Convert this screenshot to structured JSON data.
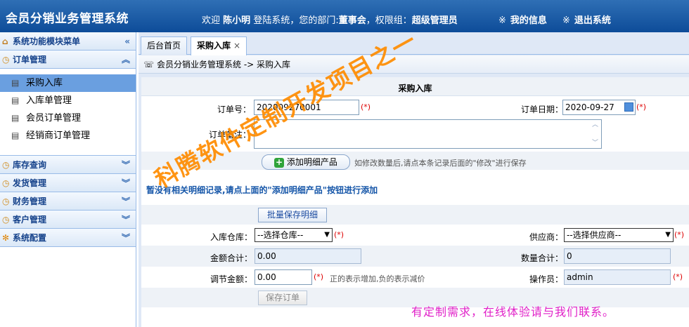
{
  "header": {
    "app_title": "会员分销业务管理系统",
    "welcome_prefix": "欢迎",
    "user_name": "陈小明",
    "welcome_mid": "登陆系统，您的部门:",
    "department": "董事会",
    "role_prefix": "，权限组：",
    "role": "超级管理员",
    "my_info": "我的信息",
    "logout": "退出系统",
    "link_mark": "※"
  },
  "sidebar": {
    "menu_title": "系统功能模块菜单",
    "groups": [
      {
        "label": "订单管理",
        "expanded": true
      },
      {
        "label": "库存查询"
      },
      {
        "label": "发货管理"
      },
      {
        "label": "财务管理"
      },
      {
        "label": "客户管理"
      },
      {
        "label": "系统配置"
      }
    ],
    "items": [
      {
        "label": "采购入库",
        "active": true
      },
      {
        "label": "入库单管理"
      },
      {
        "label": "会员订单管理"
      },
      {
        "label": "经销商订单管理"
      }
    ]
  },
  "tabs": [
    {
      "label": "后台首页"
    },
    {
      "label": "采购入库",
      "active": true,
      "close": "×"
    }
  ],
  "breadcrumb": "会员分销业务管理系统 -> 采购入库",
  "form": {
    "section_title": "采购入库",
    "order_no_label": "订单号：",
    "order_no_value": "202009270001",
    "required_mark": "(*)",
    "order_date_label": "订单日期：",
    "order_date_value": "2020-09-27",
    "remark_label": "订单备注：",
    "remark_value": "",
    "add_detail_button": "添加明细产品",
    "add_detail_note": "如修改数量后,请点本条记录后面的\"修改\"进行保存",
    "no_detail_msg": "暂没有相关明细记录,请点上面的\"添加明细产品\"按钮进行添加",
    "batch_save_button": "批量保存明细",
    "warehouse_label": "入库仓库：",
    "warehouse_value": "--选择仓库--",
    "supplier_label": "供应商：",
    "supplier_value": "--选择供应商--",
    "amount_total_label": "金额合计：",
    "amount_total_value": "0.00",
    "qty_total_label": "数量合计：",
    "qty_total_value": "0",
    "adjust_label": "调节金额：",
    "adjust_value": "0.00",
    "adjust_note": "正的表示增加,负的表示减价",
    "operator_label": "操作员：",
    "operator_value": "admin",
    "save_order_button": "保存订单"
  },
  "overlay": {
    "watermark": "科腾软件定制开发项目之一",
    "promo": "有定制需求，在线体验请与我们联系。"
  },
  "colors": {
    "header_blue": "#0d4c99",
    "active_item": "#6a9fe0",
    "watermark": "#ff8c00",
    "promo": "#e020c8",
    "required": "#dd0000"
  }
}
